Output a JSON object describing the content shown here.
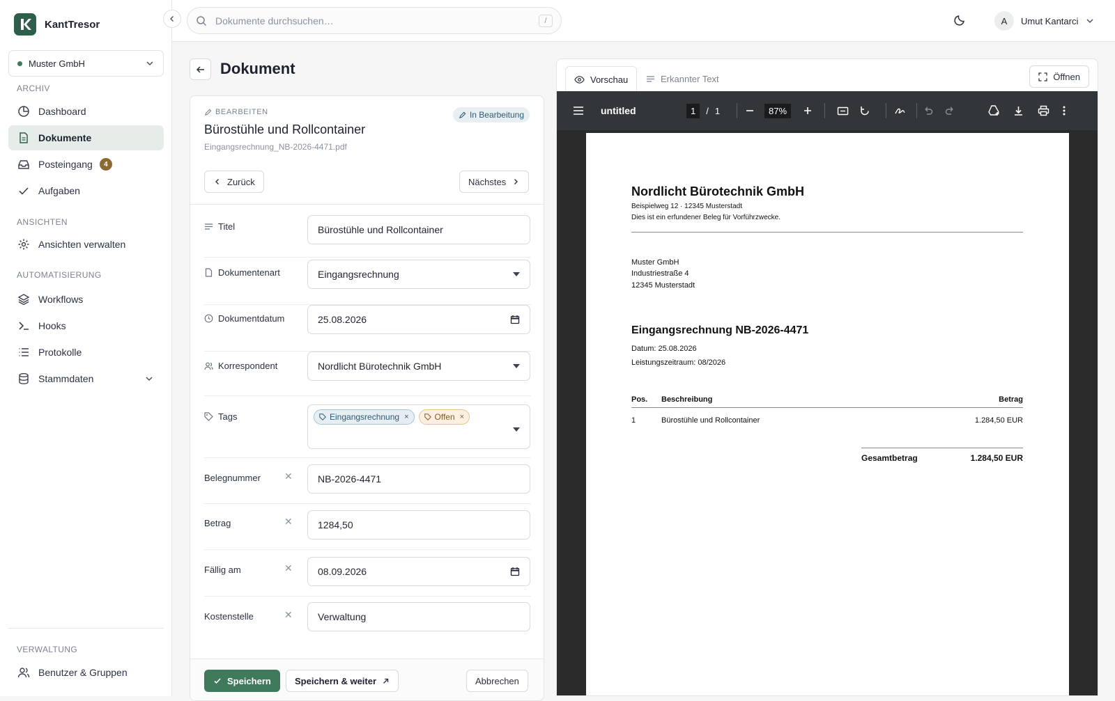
{
  "app": {
    "name": "KantTresor"
  },
  "org": {
    "name": "Muster GmbH"
  },
  "sidebar": {
    "sections": {
      "archiv": "ARCHIV",
      "ansichten": "ANSICHTEN",
      "automatisierung": "AUTOMATISIERUNG",
      "verwaltung": "VERWALTUNG"
    },
    "items": {
      "dashboard": "Dashboard",
      "dokumente": "Dokumente",
      "posteingang": "Posteingang",
      "posteingang_count": "4",
      "aufgaben": "Aufgaben",
      "ansichten": "Ansichten verwalten",
      "workflows": "Workflows",
      "hooks": "Hooks",
      "protokolle": "Protokolle",
      "stammdaten": "Stammdaten",
      "benutzer": "Benutzer & Gruppen"
    },
    "active": "dokumente"
  },
  "search": {
    "placeholder": "Dokumente durchsuchen…",
    "shortcut": "/"
  },
  "user": {
    "initial": "A",
    "name": "Umut Kantarci"
  },
  "page": {
    "title": "Dokument"
  },
  "editor": {
    "eyebrow": "BEARBEITEN",
    "status": "In Bearbeitung",
    "title": "Bürostühle und Rollcontainer",
    "filename": "Eingangsrechnung_NB-2026-4471.pdf",
    "back_label": "Zurück",
    "next_label": "Nächstes",
    "fields": {
      "titel": {
        "label": "Titel",
        "value": "Bürostühle und Rollcontainer"
      },
      "dokumentenart": {
        "label": "Dokumentenart",
        "value": "Eingangsrechnung"
      },
      "dokumentdatum": {
        "label": "Dokumentdatum",
        "value": "25.08.2026"
      },
      "korrespondent": {
        "label": "Korrespondent",
        "value": "Nordlicht Bürotechnik GmbH"
      },
      "tags": {
        "label": "Tags",
        "items": [
          "Eingangsrechnung",
          "Offen"
        ],
        "colors": [
          "#2f5b74",
          "#8a5b1f"
        ]
      },
      "belegnummer": {
        "label": "Belegnummer",
        "value": "NB-2026-4471"
      },
      "betrag": {
        "label": "Betrag",
        "value": "1284,50"
      },
      "faellig": {
        "label": "Fällig am",
        "value": "08.09.2026"
      },
      "kostenstelle": {
        "label": "Kostenstelle",
        "value": "Verwaltung"
      }
    },
    "save_label": "Speichern",
    "save_next_label": "Speichern & weiter",
    "cancel_label": "Abbrechen"
  },
  "preview": {
    "tab_preview": "Vorschau",
    "tab_text": "Erkannter Text",
    "open_label": "Öffnen",
    "toolbar": {
      "filename": "untitled",
      "page": "1",
      "separator": "/",
      "pages": "1",
      "zoom": "87%"
    },
    "pdf": {
      "company": "Nordlicht Bürotechnik GmbH",
      "address": "Beispielweg 12 · 12345 Musterstadt",
      "note": "Dies ist ein erfundener Beleg für Vorführzwecke.",
      "recipient": [
        "Muster GmbH",
        "Industriestraße 4",
        "12345 Musterstadt"
      ],
      "heading": "Eingangsrechnung NB-2026-4471",
      "date": "Datum: 25.08.2026",
      "period": "Leistungszeitraum: 08/2026",
      "col_pos": "Pos.",
      "col_desc": "Beschreibung",
      "col_amount": "Betrag",
      "rows": [
        {
          "pos": "1",
          "desc": "Bürostühle und Rollcontainer",
          "amount": "1.284,50 EUR"
        }
      ],
      "total_label": "Gesamtbetrag",
      "total_value": "1.284,50 EUR"
    }
  },
  "colors": {
    "brand": "#3f7a5c",
    "badge": "#8a6a32",
    "status_bg": "#e7eff3",
    "pdf_toolbar": "#323639"
  }
}
